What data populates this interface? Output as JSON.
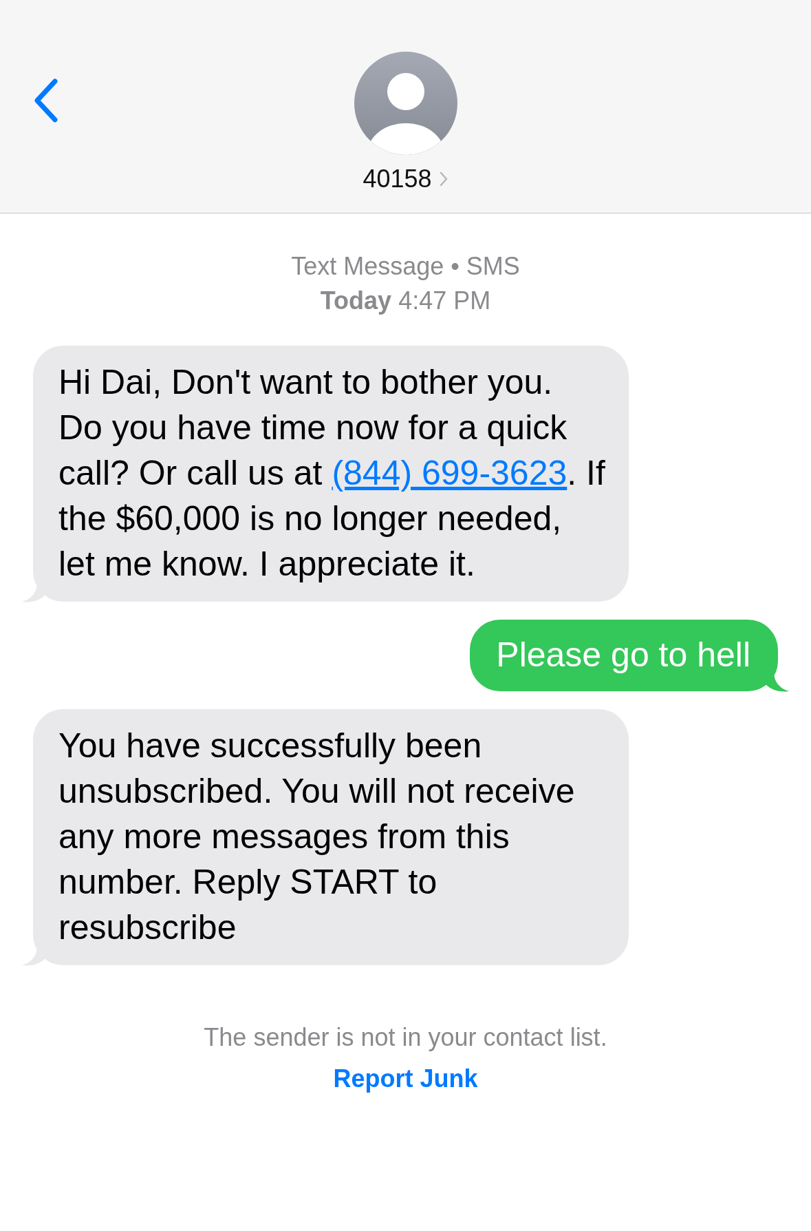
{
  "header": {
    "contact": "40158"
  },
  "meta": {
    "service": "Text Message • SMS",
    "time_label": "Today",
    "time": "4:47 PM"
  },
  "messages": [
    {
      "kind": "received",
      "parts": [
        {
          "kind": "text",
          "text": "Hi Dai, Don't want to bother you.  Do you have time now for a quick call? Or call us at "
        },
        {
          "kind": "link",
          "text": "(844) 699-3623"
        },
        {
          "kind": "text",
          "text": ". If the $60,000 is no longer needed, let me know. I appreciate it."
        }
      ]
    },
    {
      "kind": "sent",
      "parts": [
        {
          "kind": "text",
          "text": "Please go to hell"
        }
      ]
    },
    {
      "kind": "received",
      "parts": [
        {
          "kind": "text",
          "text": "You have successfully been unsubscribed. You will not receive any more messages from this number. Reply START to resubscribe"
        }
      ]
    }
  ],
  "footer": {
    "notice": "The sender is not in your contact list.",
    "action": "Report Junk"
  }
}
